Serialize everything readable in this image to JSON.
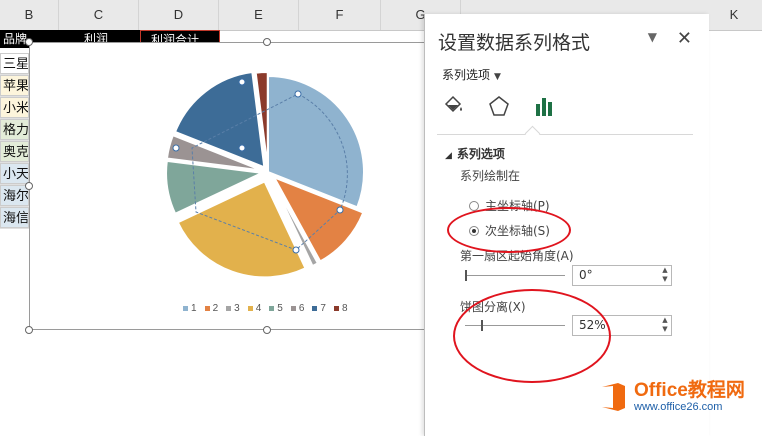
{
  "spreadsheet": {
    "columns": [
      "B",
      "C",
      "D",
      "E",
      "F",
      "G",
      "K"
    ],
    "header_cells": [
      "品牌",
      "利润",
      "利润合计"
    ],
    "row_labels": [
      "三星",
      "苹果",
      "小米",
      "格力",
      "奥克",
      "小天",
      "海尔",
      "海信"
    ]
  },
  "chart": {
    "legend_colors": [
      "#8fb3cf",
      "#e38244",
      "#a5a5a5",
      "#e2b14c",
      "#7fa69a",
      "#9b9393",
      "#3d6c97",
      "#8b3a2b"
    ]
  },
  "chart_data": {
    "type": "pie",
    "categories": [
      "1",
      "2",
      "3",
      "4",
      "5",
      "6",
      "7",
      "8"
    ],
    "values": [
      31,
      11,
      1,
      25,
      9,
      4,
      17,
      2
    ],
    "legend_position": "bottom"
  },
  "pane": {
    "title": "设置数据系列格式",
    "collapse_icon": "chevron-down-icon",
    "close_label": "✕",
    "options_dropdown": "系列选项",
    "icons": [
      "fill-bucket-icon",
      "pentagon-icon",
      "bar-chart-icon"
    ],
    "section_title": "系列选项",
    "plot_on_label": "系列绘制在",
    "primary_axis_label": "主坐标轴(P)",
    "secondary_axis_label": "次坐标轴(S)",
    "secondary_selected": true,
    "first_slice_angle_label": "第一扇区起始角度(A)",
    "first_slice_angle_value": "0°",
    "first_slice_angle_fraction": 0,
    "explosion_label": "饼图分离(X)",
    "explosion_value": "52%",
    "explosion_fraction": 0.52
  },
  "watermark": {
    "line1": "Office教程网",
    "line2": "www.office26.com"
  }
}
